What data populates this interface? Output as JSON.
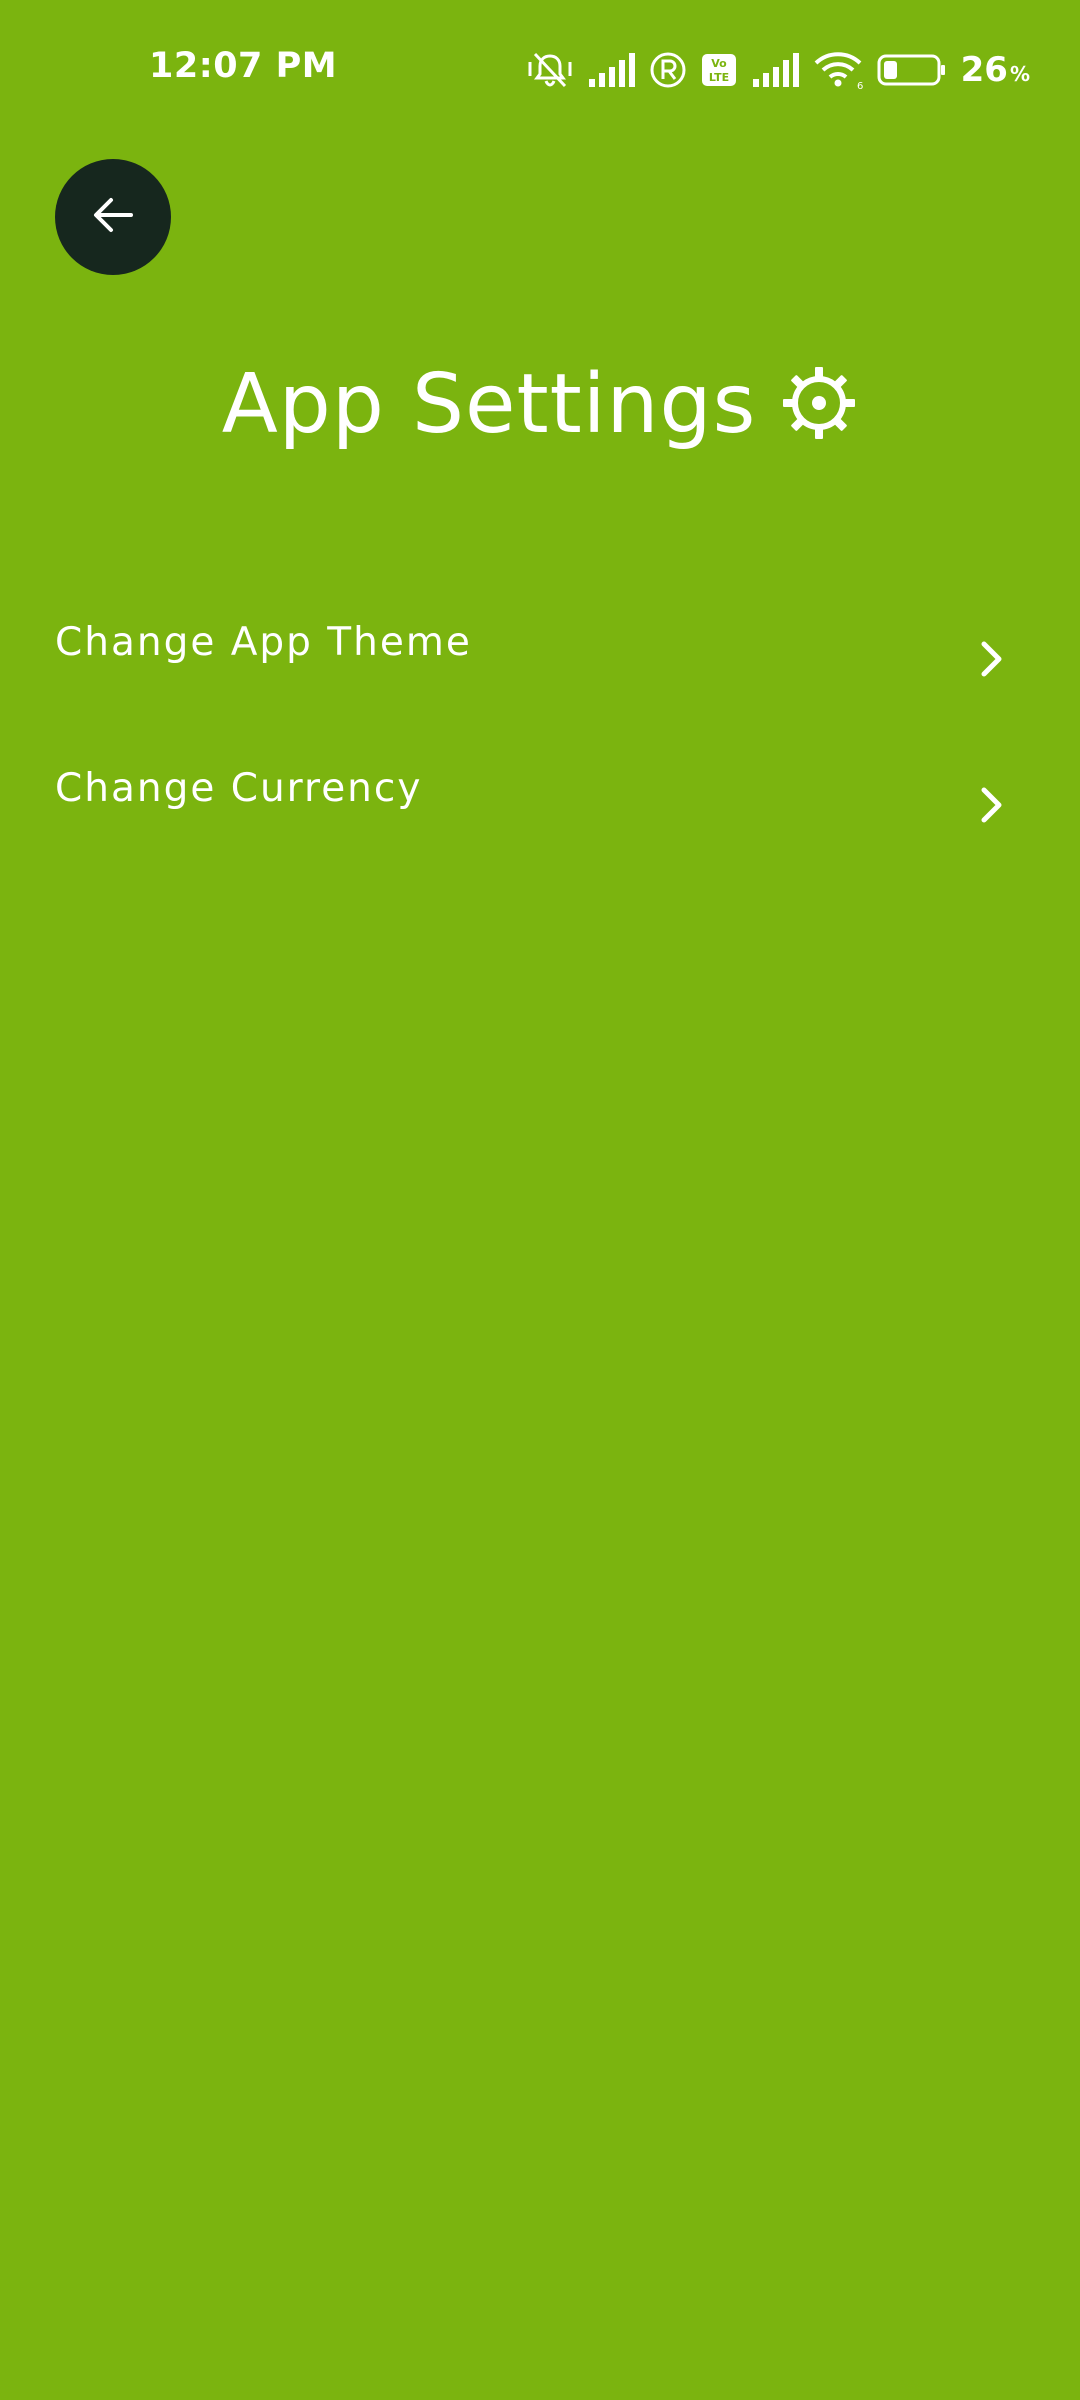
{
  "status_bar": {
    "time": "12:07 PM",
    "battery_level": "26",
    "battery_unit": "%",
    "network_badge": "Vo LTE",
    "icons": [
      "vibrate-mute-icon",
      "signal-icon",
      "roaming-icon",
      "volte-icon",
      "signal-icon",
      "wifi-icon",
      "battery-icon"
    ]
  },
  "header": {
    "back_icon": "arrow-left-icon",
    "title": "App Settings",
    "title_icon": "gear-icon"
  },
  "settings": {
    "items": [
      {
        "label": "Change App Theme",
        "icon": "chevron-right-icon"
      },
      {
        "label": "Change Currency",
        "icon": "chevron-right-icon"
      }
    ]
  },
  "colors": {
    "background": "#7bb40f",
    "back_button": "#16271e",
    "text": "#ffffff"
  }
}
